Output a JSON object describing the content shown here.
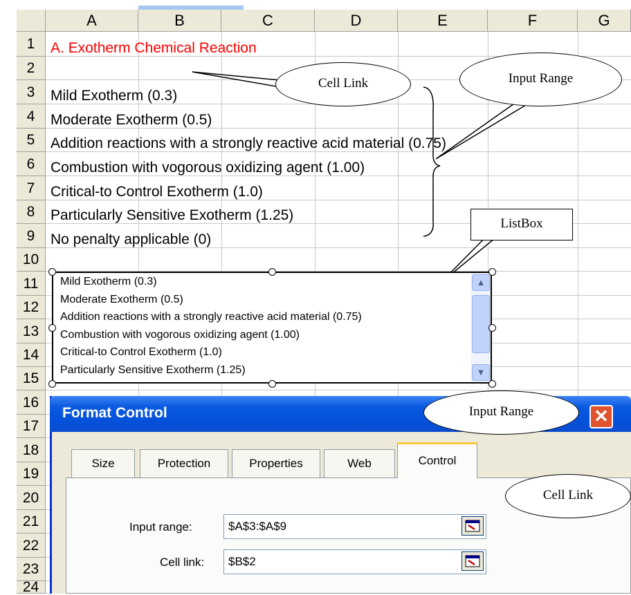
{
  "columns": [
    "A",
    "B",
    "C",
    "D",
    "E",
    "F",
    "G"
  ],
  "rows": [
    "1",
    "2",
    "3",
    "4",
    "5",
    "6",
    "7",
    "8",
    "9",
    "10",
    "11",
    "12",
    "13",
    "14",
    "15",
    "16",
    "17",
    "18",
    "19",
    "20",
    "21",
    "22",
    "23",
    "24"
  ],
  "cells": {
    "a1": "A. Exotherm Chemical Reaction",
    "a3": "Mild Exotherm (0.3)",
    "a4": "Moderate Exotherm (0.5)",
    "a5": "Addition reactions with a strongly reactive acid material (0.75)",
    "a6": "Combustion with vogorous oxidizing agent (1.00)",
    "a7": "Critical-to Control Exotherm (1.0)",
    "a8": "Particularly Sensitive Exotherm (1.25)",
    "a9": "No penalty applicable (0)"
  },
  "listbox": {
    "items": [
      "Mild Exotherm (0.3)",
      "Moderate Exotherm (0.5)",
      "Addition reactions with a strongly reactive acid material (0.75)",
      "Combustion with vogorous oxidizing agent (1.00)",
      "Critical-to Control Exotherm (1.0)",
      "Particularly Sensitive Exotherm (1.25)"
    ]
  },
  "callouts": {
    "cell_link_top": "Cell Link",
    "input_range_top": "Input Range",
    "listbox": "ListBox",
    "input_range_dialog": "Input Range",
    "cell_link_dialog": "Cell Link"
  },
  "dialog": {
    "title": "Format Control",
    "close": "✕",
    "tabs": [
      "Size",
      "Protection",
      "Properties",
      "Web",
      "Control"
    ],
    "active_tab": "Control",
    "input_range_label": "Input range:",
    "input_range_value": "$A$3:$A$9",
    "cell_link_label": "Cell link:",
    "cell_link_value": "$B$2"
  },
  "colors": {
    "title_text": "#ff0000",
    "dialog_titlebar": "#0551d9"
  }
}
